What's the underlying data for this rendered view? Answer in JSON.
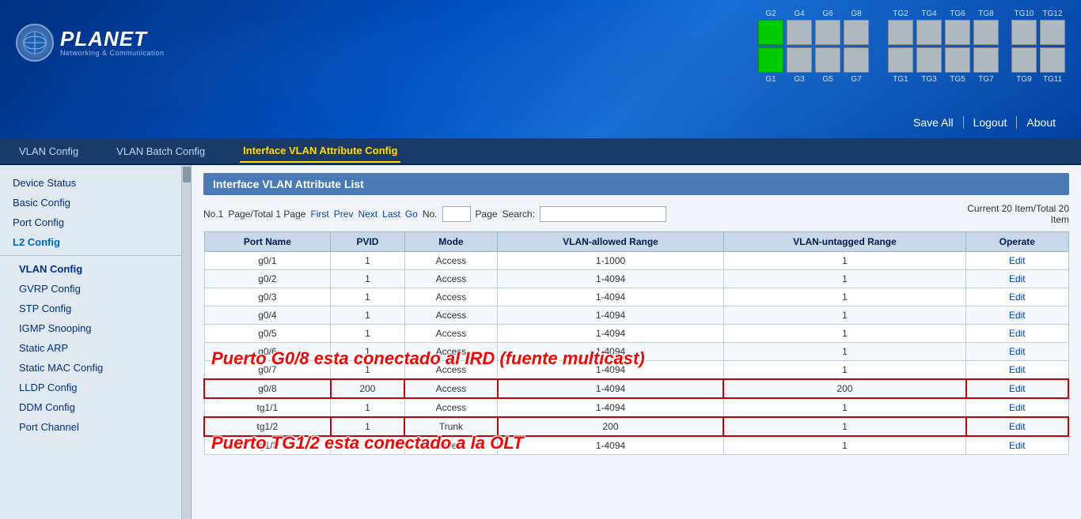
{
  "header": {
    "logo_planet": "PLANET",
    "logo_sub": "Networking & Communication",
    "nav_save_all": "Save All",
    "nav_logout": "Logout",
    "nav_about": "About"
  },
  "ports_top": {
    "labels": [
      "G2",
      "G4",
      "G6",
      "G8",
      "TG2",
      "TG4",
      "TG6",
      "TG8",
      "TG10",
      "TG12"
    ],
    "active": [
      0
    ],
    "tg_start": 4
  },
  "ports_bottom": {
    "labels": [
      "G1",
      "G3",
      "G5",
      "G7",
      "TG1",
      "TG3",
      "TG5",
      "TG7",
      "TG9",
      "TG11"
    ],
    "active": [
      0
    ]
  },
  "menu": {
    "items": [
      {
        "label": "VLAN Config",
        "active": false
      },
      {
        "label": "VLAN Batch Config",
        "active": false
      },
      {
        "label": "Interface VLAN Attribute Config",
        "active": true
      }
    ]
  },
  "sidebar": {
    "items": [
      {
        "label": "Device Status",
        "active": false,
        "section": false
      },
      {
        "label": "Basic Config",
        "active": false,
        "section": false
      },
      {
        "label": "Port Config",
        "active": false,
        "section": false
      },
      {
        "label": "L2 Config",
        "active": true,
        "section": false
      },
      {
        "label": "VLAN Config",
        "active": false,
        "sub": true,
        "bold": true
      },
      {
        "label": "GVRP Config",
        "active": false,
        "sub": true
      },
      {
        "label": "STP Config",
        "active": false,
        "sub": true
      },
      {
        "label": "IGMP Snooping",
        "active": false,
        "sub": true
      },
      {
        "label": "Static ARP",
        "active": false,
        "sub": true
      },
      {
        "label": "Static MAC Config",
        "active": false,
        "sub": true
      },
      {
        "label": "LLDP Config",
        "active": false,
        "sub": true
      },
      {
        "label": "DDM Config",
        "active": false,
        "sub": true
      },
      {
        "label": "Port Channel",
        "active": false,
        "sub": true
      }
    ]
  },
  "content": {
    "title": "Interface VLAN Attribute List",
    "pagination": {
      "no": "No.1",
      "page_total": "Page/Total 1 Page",
      "first": "First",
      "prev": "Prev",
      "next": "Next",
      "last": "Last",
      "go": "Go",
      "no_label": "No.",
      "page_label": "Page",
      "search_label": "Search:",
      "current_info": "Current 20 Item/Total 20",
      "item_label": "Item"
    },
    "table": {
      "headers": [
        "Port Name",
        "PVID",
        "Mode",
        "VLAN-allowed Range",
        "VLAN-untagged Range",
        "Operate"
      ],
      "rows": [
        {
          "port": "g0/1",
          "pvid": "1",
          "mode": "Access",
          "allowed": "1-1000",
          "untagged": "1",
          "op": "Edit"
        },
        {
          "port": "g0/2",
          "pvid": "1",
          "mode": "Access",
          "allowed": "1-4094",
          "untagged": "1",
          "op": "Edit"
        },
        {
          "port": "g0/3",
          "pvid": "1",
          "mode": "Access",
          "allowed": "1-4094",
          "untagged": "1",
          "op": "Edit"
        },
        {
          "port": "g0/4",
          "pvid": "1",
          "mode": "Access",
          "allowed": "1-4094",
          "untagged": "1",
          "op": "Edit"
        },
        {
          "port": "g0/5",
          "pvid": "1",
          "mode": "Access",
          "allowed": "1-4094",
          "untagged": "1",
          "op": "Edit"
        },
        {
          "port": "g0/6",
          "pvid": "1",
          "mode": "Access",
          "allowed": "1-4094",
          "untagged": "1",
          "op": "Edit"
        },
        {
          "port": "g0/7",
          "pvid": "1",
          "mode": "Access",
          "allowed": "1-4094",
          "untagged": "1",
          "op": "Edit",
          "highlighted": false
        },
        {
          "port": "g0/8",
          "pvid": "200",
          "mode": "Access",
          "allowed": "1-4094",
          "untagged": "200",
          "op": "Edit",
          "highlighted": true
        },
        {
          "port": "tg1/1",
          "pvid": "1",
          "mode": "Access",
          "allowed": "1-4094",
          "untagged": "1",
          "op": "Edit"
        },
        {
          "port": "tg1/2",
          "pvid": "1",
          "mode": "Trunk",
          "allowed": "200",
          "untagged": "1",
          "op": "Edit",
          "highlighted": true
        },
        {
          "port": "tg1/3",
          "pvid": "1",
          "mode": "Access",
          "allowed": "1-4094",
          "untagged": "1",
          "op": "Edit"
        }
      ]
    },
    "overlay1": "Puerto G0/8 esta conectado al IRD (fuente multicast)",
    "overlay2": "Puerto TG1/2 esta conectado a la OLT"
  },
  "colors": {
    "active_port": "#00cc00",
    "accent": "#4a7ab5",
    "link": "#0044cc",
    "highlight_border": "#cc0000",
    "overlay_text": "red"
  }
}
